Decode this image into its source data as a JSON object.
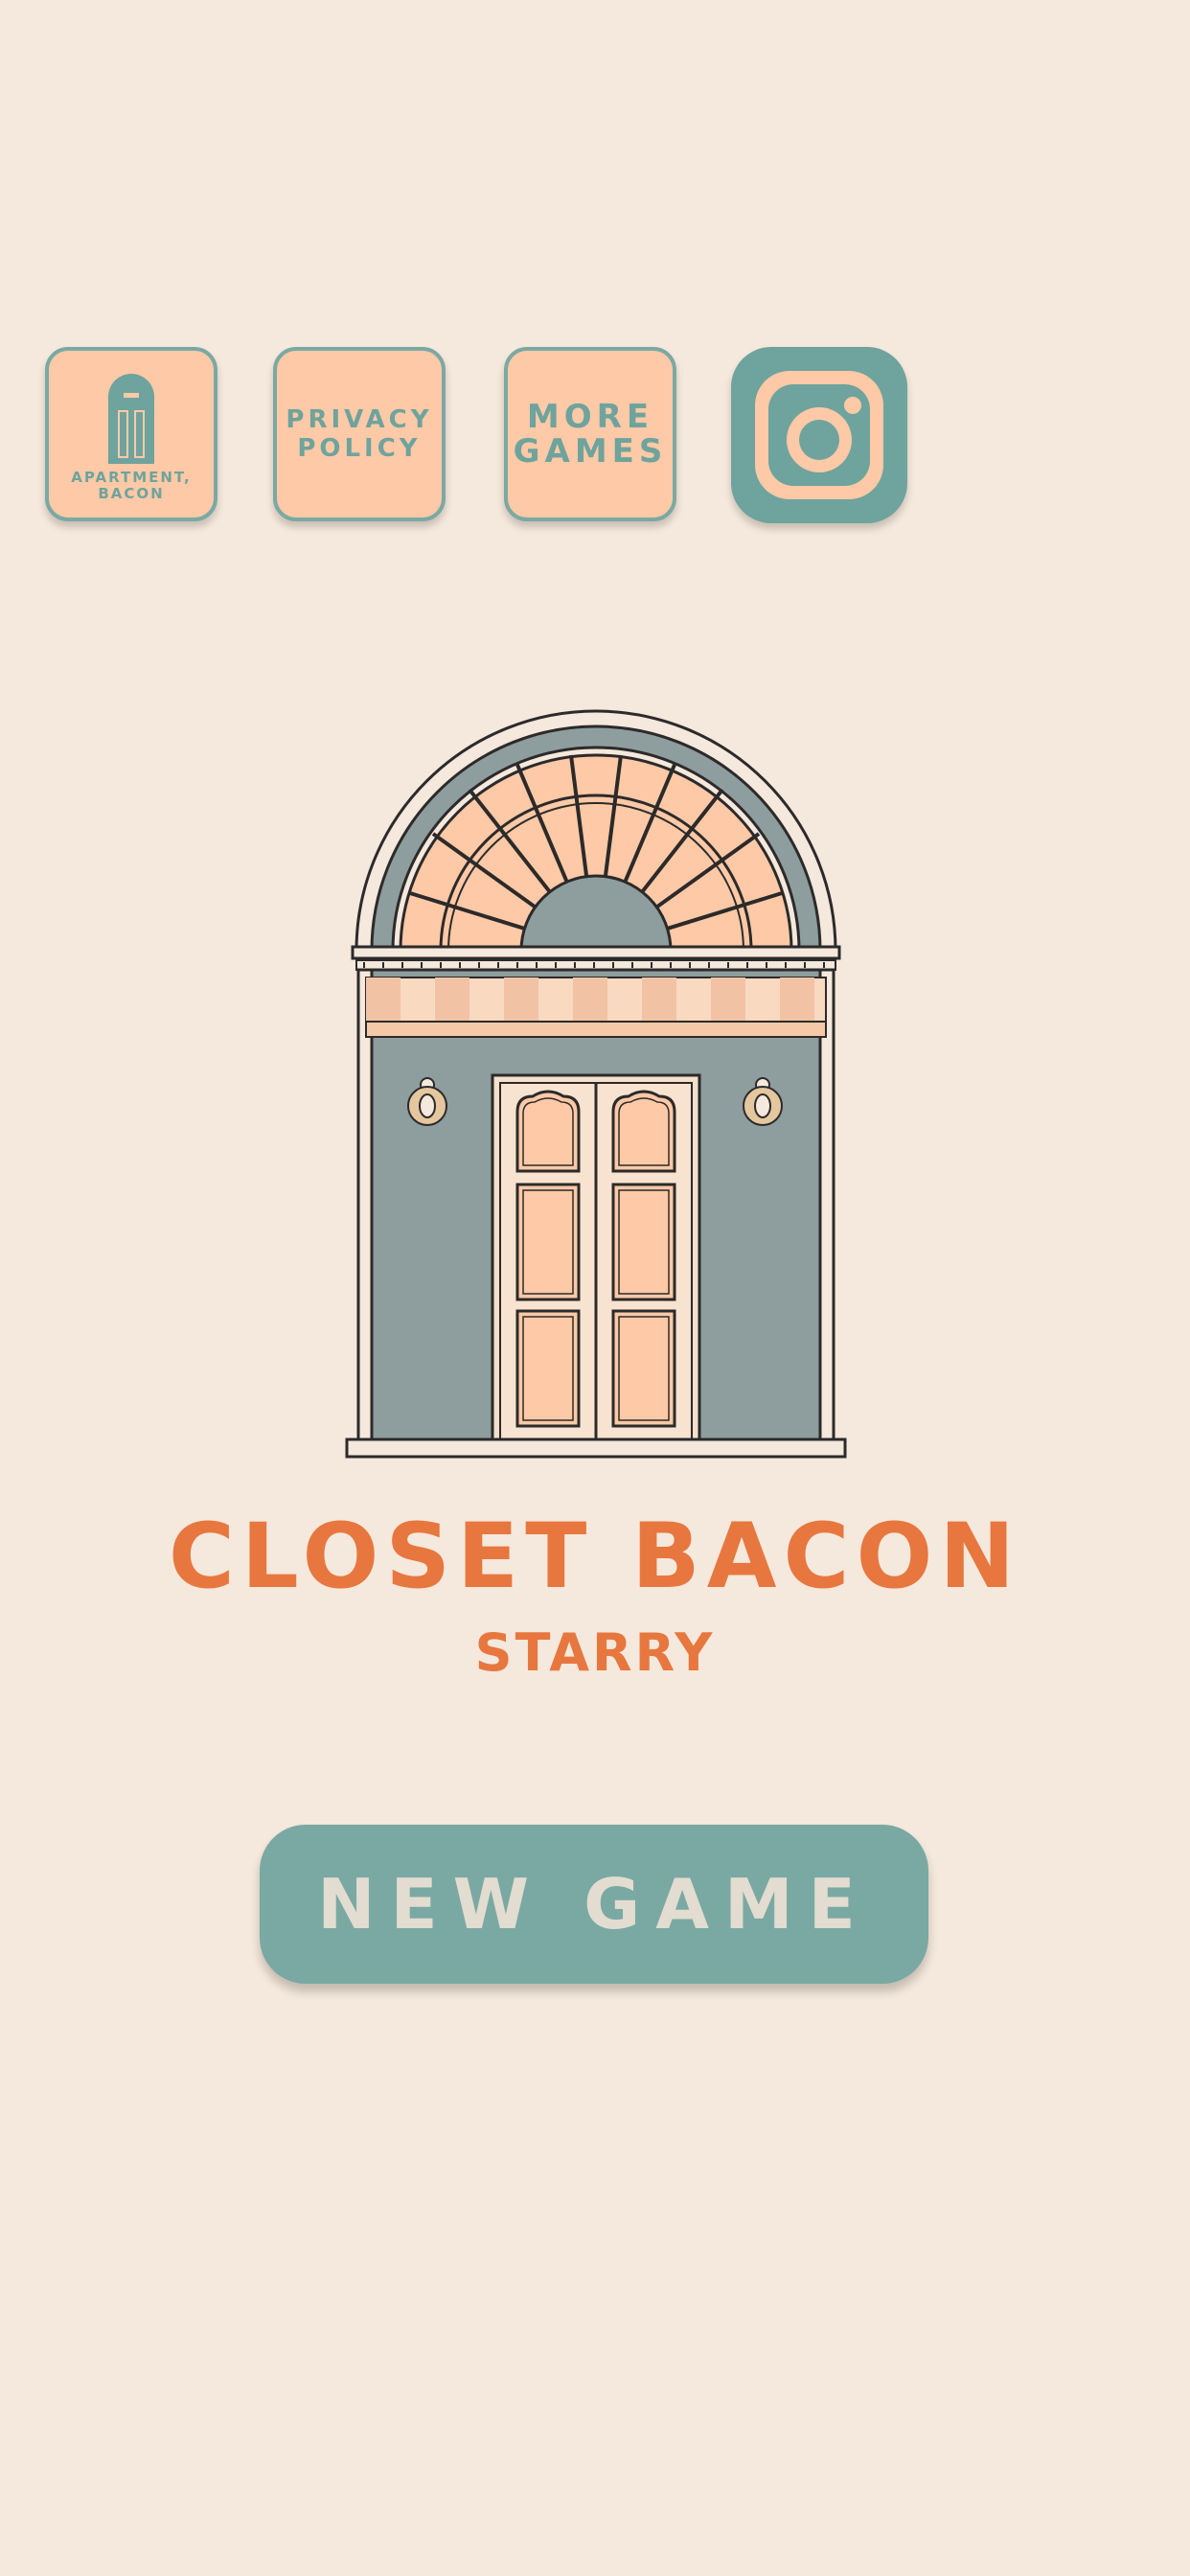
{
  "top_menu": {
    "apartment_label": "APARTMENT,\nBACON",
    "privacy_label": "PRIVACY\nPOLICY",
    "more_games_label": "MORE\nGAMES",
    "instagram_icon": "instagram-icon"
  },
  "title": {
    "main": "CLOSET BACON",
    "sub": "STARRY"
  },
  "actions": {
    "new_game_label": "NEW GAME"
  },
  "colors": {
    "background": "#f5e8dc",
    "accent_orange": "#e7773f",
    "teal": "#7aa9a3",
    "peach": "#fdc9a6",
    "wall_gray": "#8e9d9d"
  }
}
